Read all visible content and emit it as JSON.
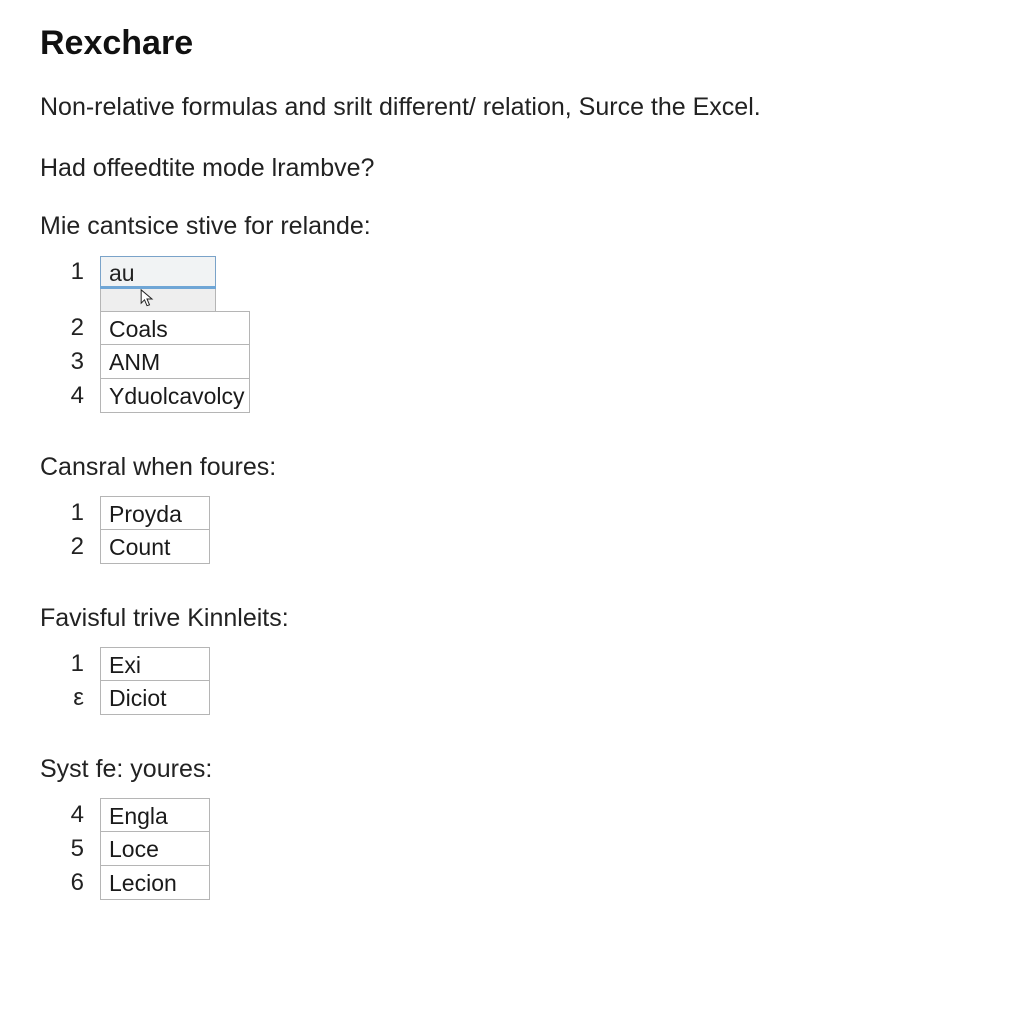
{
  "title": "Rexchare",
  "paragraph1": "Non-relative formulas and srilt different/ relation, Surce the Excel.",
  "paragraph2": "Had offeedtite mode lrambve?",
  "sections": [
    {
      "label": "Mie cantsice stive for relande:",
      "rows": [
        {
          "num": "1",
          "value": "au"
        },
        {
          "num": "2",
          "value": "Coals"
        },
        {
          "num": "3",
          "value": "ANM"
        },
        {
          "num": "4",
          "value": "Yduolcavolcy"
        }
      ]
    },
    {
      "label": "Cansral when foures:",
      "rows": [
        {
          "num": "1",
          "value": "Proyda"
        },
        {
          "num": "2",
          "value": "Count"
        }
      ]
    },
    {
      "label": "Favisful trive Kinnleits:",
      "rows": [
        {
          "num": "1",
          "value": "Exi"
        },
        {
          "num": "ε",
          "value": "Diciot"
        }
      ]
    },
    {
      "label": "Syst fe: youres:",
      "rows": [
        {
          "num": "4",
          "value": "Engla"
        },
        {
          "num": "5",
          "value": "Loce"
        },
        {
          "num": "6",
          "value": "Lecion"
        }
      ]
    }
  ]
}
